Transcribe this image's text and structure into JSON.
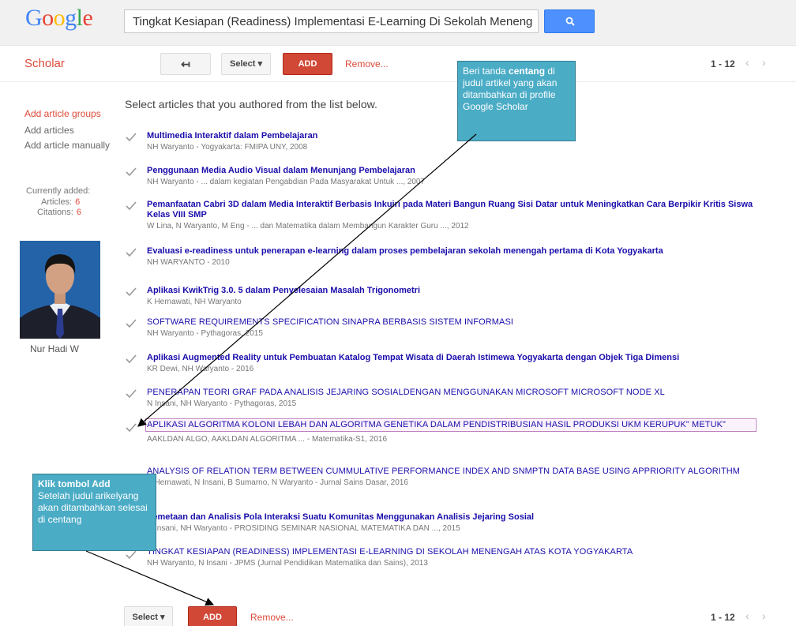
{
  "logo": {
    "g1": "G",
    "o1": "o",
    "o2": "o",
    "g2": "g",
    "l": "l",
    "e": "e"
  },
  "search": {
    "value": "Tingkat Kesiapan (Readiness) Implementasi E-Learning Di Sekolah Meneng"
  },
  "toolbar": {
    "scholar_label": "Scholar",
    "back_label": "↤",
    "select_label": "Select ▾",
    "add_label": "ADD",
    "remove_label": "Remove...",
    "page_range": "1 - 12",
    "prev": "‹",
    "next": "›"
  },
  "sidebar": {
    "links": [
      {
        "label": "Add article groups"
      },
      {
        "label": "Add articles"
      },
      {
        "label": "Add article manually"
      }
    ],
    "currently_added": "Currently added:",
    "articles_label": "Articles:",
    "articles_count": "6",
    "citations_label": "Citations:",
    "citations_count": "6",
    "profile_name": "Nur Hadi W"
  },
  "instruction": "Select articles that you authored from the list below.",
  "articles": [
    {
      "title": "Multimedia Interaktif dalam Pembelajaran",
      "meta": "NH Waryanto - Yogyakarta: FMIPA UNY, 2008"
    },
    {
      "title": "Penggunaan Media Audio Visual dalam Menunjang Pembelajaran",
      "meta": "NH Waryanto - ... dalam kegiatan Pengabdian Pada Masyarakat Untuk ..., 2007"
    },
    {
      "title": "Pemanfaatan Cabri 3D dalam Media Interaktif Berbasis Inkuiri pada Materi Bangun Ruang Sisi Datar untuk Meningkatkan Cara Berpikir Kritis Siswa Kelas VIII SMP",
      "meta": "W Lina, N Waryanto, M Eng - ... dan Matematika dalam Membangun Karakter Guru ..., 2012"
    },
    {
      "title": "Evaluasi e-readiness untuk penerapan e-learning dalam proses pembelajaran sekolah menengah pertama di Kota Yogyakarta",
      "meta": "NH WARYANTO - 2010"
    },
    {
      "title": "Aplikasi KwikTrig 3.0. 5 dalam Penyelesaian Masalah Trigonometri",
      "meta": "K Hernawati, NH Waryanto"
    },
    {
      "title": "SOFTWARE REQUIREMENTS SPECIFICATION SINAPRA BERBASIS SISTEM INFORMASI",
      "meta": "NH Waryanto - Pythagoras, 2015"
    },
    {
      "title": "Aplikasi Augmented Reality untuk Pembuatan Katalog Tempat Wisata di Daerah Istimewa Yogyakarta dengan Objek Tiga Dimensi",
      "meta": "KR Dewi, NH Waryanto - 2016"
    },
    {
      "title": "PENERAPAN TEORI GRAF PADA ANALISIS JEJARING SOSIALDENGAN MENGGUNAKAN MICROSOFT MICROSOFT NODE XL",
      "meta": "N Insani, NH Waryanto - Pythagoras, 2015"
    },
    {
      "title": "APLIKASI ALGORITMA KOLONI LEBAH DAN ALGORITMA GENETIKA DALAM PENDISTRIBUSIAN HASIL PRODUKSI UKM KERUPUK\" METUK\"",
      "meta": "AAKLDAN ALGO, AAKLDAN ALGORITMA ... - Matematika-S1, 2016"
    },
    {
      "title": "ANALYSIS OF RELATION TERM BETWEEN CUMMULATIVE PERFORMANCE INDEX AND SNMPTN DATA BASE USING APPRIORITY ALGORITHM",
      "meta": "K Hernawati, N Insani, B Sumarno, N Waryanto - Jurnal Sains Dasar, 2016"
    },
    {
      "title": "Pemetaan dan Analisis Pola Interaksi Suatu Komunitas Menggunakan Analisis Jejaring Sosial",
      "meta": "N Insani, NH Waryanto - PROSIDING SEMINAR NASIONAL MATEMATIKA DAN ..., 2015"
    },
    {
      "title": "TINGKAT KESIAPAN (READINESS) IMPLEMENTASI E-LEARNING DI SEKOLAH MENENGAH ATAS KOTA YOGYAKARTA",
      "meta": "NH Waryanto, N Insani - JPMS (Jurnal Pendidikan Matematika dan Sains), 2013"
    }
  ],
  "bottom": {
    "select_label": "Select ▾",
    "add_label": "ADD",
    "remove_label": "Remove...",
    "page_range": "1 - 12",
    "prev": "‹",
    "next": "›"
  },
  "callout_top": {
    "line1_pre": "Beri tanda ",
    "line1_bold": "centang",
    "rest": "di judul artikel yang akan ditambahkan di profile Google Scholar"
  },
  "callout_left": {
    "bold": "Klik tombol Add",
    "rest": "Setelah judul arikelyang akan ditambahkan selesai di centang"
  },
  "colors": {
    "accent_red": "#d14836",
    "link_blue": "#1a0dab",
    "callout": "#4bacc6",
    "scholar_red": "#dd4b39"
  }
}
